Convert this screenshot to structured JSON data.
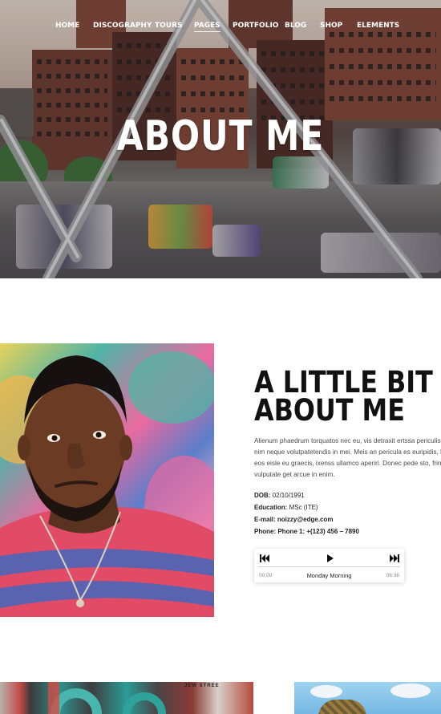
{
  "nav": {
    "items": [
      {
        "label": "HOME",
        "active": false
      },
      {
        "label": "DISCOGRAPHY",
        "active": false
      },
      {
        "label": "TOURS",
        "active": false
      },
      {
        "label": "PAGES",
        "active": true
      },
      {
        "label": "PORTFOLIO",
        "active": false
      },
      {
        "label": "BLOG",
        "active": false
      },
      {
        "label": "SHOP",
        "active": false
      },
      {
        "label": "ELEMENTS",
        "active": false
      }
    ]
  },
  "hero": {
    "title": "ABOUT ME"
  },
  "about": {
    "heading_line1": "A LITTLE BIT",
    "heading_line2": "ABOUT ME",
    "paragraph_lines": [
      "Alienum phaedrum torquatos nec eu, vis detraxit ertssa periculise",
      "nim neque volutpatetendis in mei. Meis an pericula es euripidis, hi",
      "eos eisle eu graecis, ixenss ullamco aperiri. Donec pede sto, fringill",
      "vulputate get arcue in enim."
    ],
    "details": [
      {
        "label": "DOB:",
        "value": "02/10/1991"
      },
      {
        "label": "Education:",
        "value": "MSc (ITE)"
      },
      {
        "label": "E-mail:",
        "value": "noizzy@edge.com"
      },
      {
        "label": "Phone:",
        "value": "Phone 1: +(123) 456 – 7890"
      }
    ]
  },
  "player": {
    "prev_icon": "skip-previous-icon",
    "play_icon": "play-icon",
    "next_icon": "skip-next-icon",
    "current_time": "00:00",
    "track_title": "Monday Morning",
    "duration": "06:36",
    "progress": 0
  },
  "gallery": {
    "sign_text": "JEW STREE"
  },
  "colors": {
    "title_text": "#111111",
    "body_text": "#4a4a4a",
    "nav_text": "#ffffff"
  }
}
